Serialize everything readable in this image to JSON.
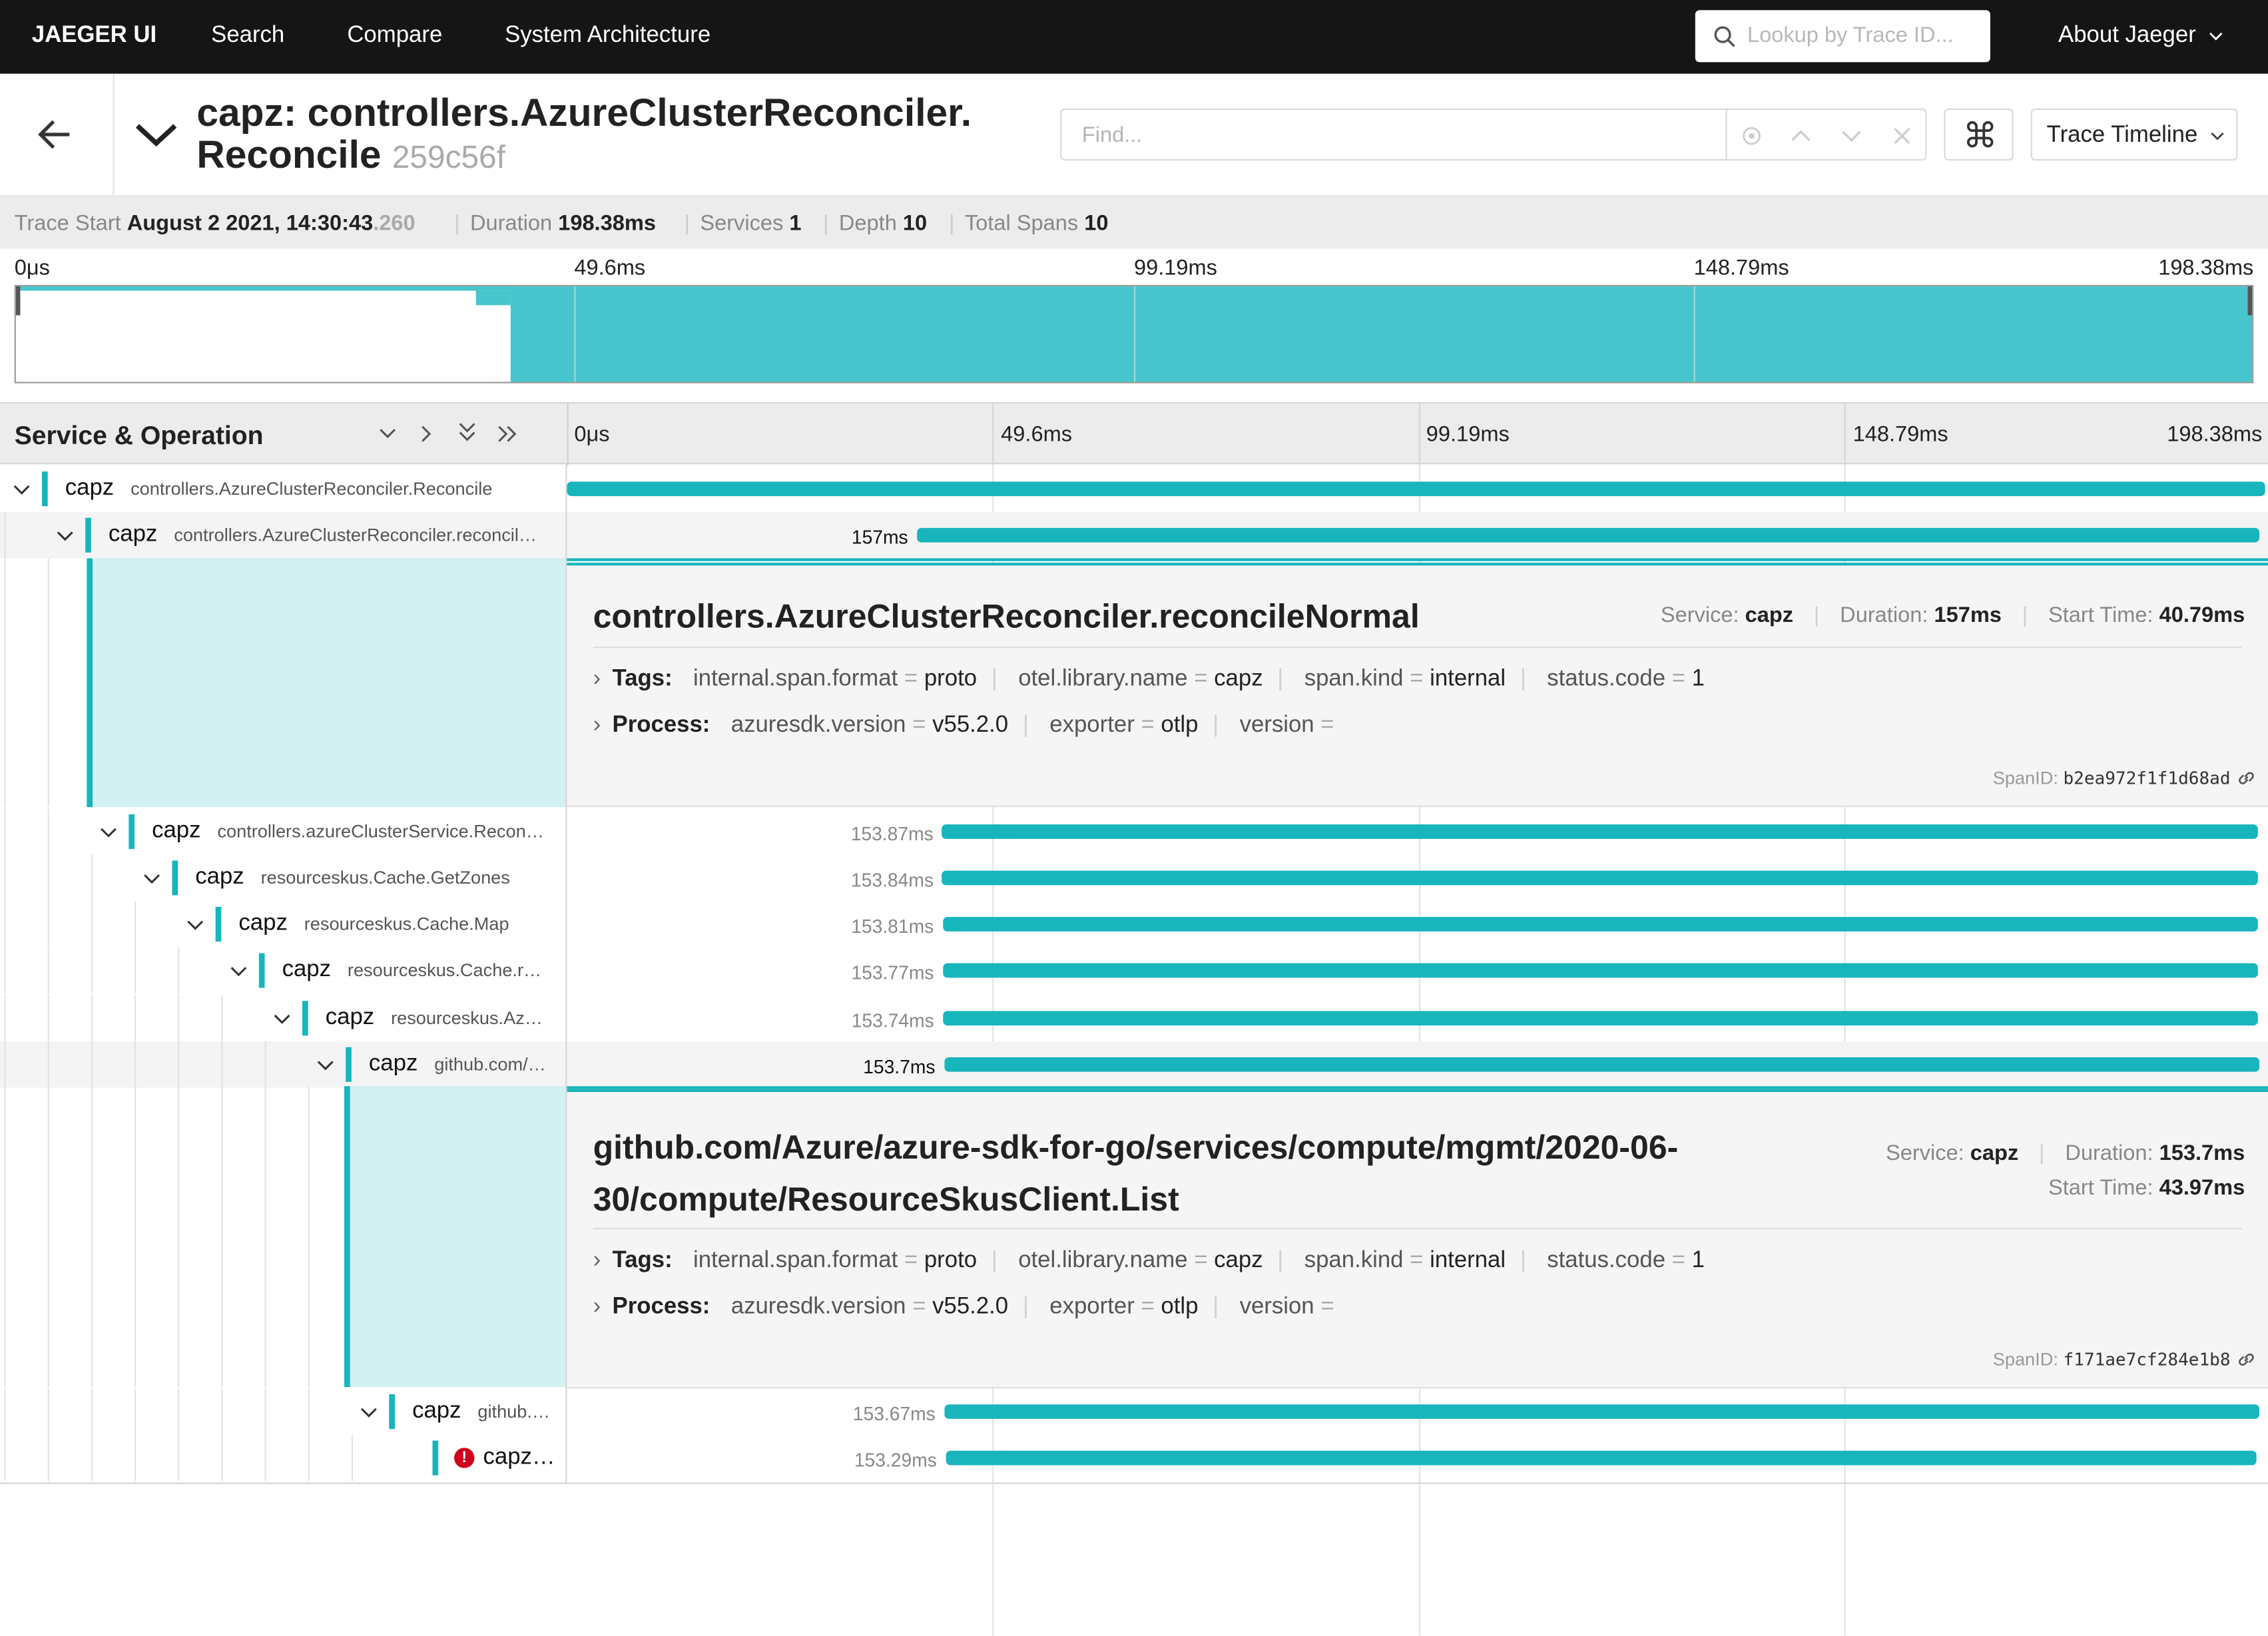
{
  "nav": {
    "brand": "JAEGER UI",
    "search": "Search",
    "compare": "Compare",
    "system_architecture": "System Architecture",
    "lookup_placeholder": "Lookup by Trace ID...",
    "about": "About Jaeger"
  },
  "trace": {
    "title_line1": "capz: controllers.AzureClusterReconciler.",
    "title_line2": "Reconcile",
    "trace_id": "259c56f",
    "find_placeholder": "Find...",
    "view_label": "Trace Timeline"
  },
  "summary": {
    "start_label": "Trace Start",
    "start_value": "August 2 2021, 14:30:43",
    "start_ms": ".260",
    "duration_label": "Duration",
    "duration_value": "198.38ms",
    "services_label": "Services",
    "services_value": "1",
    "depth_label": "Depth",
    "depth_value": "10",
    "spans_label": "Total Spans",
    "spans_value": "10"
  },
  "ticks": [
    "0μs",
    "49.6ms",
    "99.19ms",
    "148.79ms",
    "198.38ms"
  ],
  "grid": {
    "header_title": "Service & Operation"
  },
  "spans": [
    {
      "service": "capz",
      "operation": "controllers.AzureClusterReconciler.Reconcile",
      "duration": "",
      "start_frac": 0.0,
      "dur_frac": 1.0
    },
    {
      "service": "capz",
      "operation": "controllers.AzureClusterReconciler.reconcil…",
      "duration": "157ms",
      "start_frac": 0.2056,
      "dur_frac": 0.7914
    },
    {
      "service": "capz",
      "operation": "controllers.azureClusterService.Recon…",
      "duration": "153.87ms",
      "start_frac": 0.2205,
      "dur_frac": 0.7756
    },
    {
      "service": "capz",
      "operation": "resourceskus.Cache.GetZones",
      "duration": "153.84ms",
      "start_frac": 0.2206,
      "dur_frac": 0.7755
    },
    {
      "service": "capz",
      "operation": "resourceskus.Cache.Map",
      "duration": "153.81ms",
      "start_frac": 0.2207,
      "dur_frac": 0.7753
    },
    {
      "service": "capz",
      "operation": "resourceskus.Cache.r…",
      "duration": "153.77ms",
      "start_frac": 0.2208,
      "dur_frac": 0.7751
    },
    {
      "service": "capz",
      "operation": "resourceskus.Az…",
      "duration": "153.74ms",
      "start_frac": 0.2209,
      "dur_frac": 0.775
    },
    {
      "service": "capz",
      "operation": "github.com/…",
      "duration": "153.7ms",
      "start_frac": 0.2216,
      "dur_frac": 0.7748
    },
    {
      "service": "capz",
      "operation": "github.…",
      "duration": "153.67ms",
      "start_frac": 0.2217,
      "dur_frac": 0.7746
    },
    {
      "service": "capz…",
      "operation": "",
      "duration": "153.29ms",
      "start_frac": 0.2225,
      "dur_frac": 0.7727
    }
  ],
  "detail1": {
    "operation": "controllers.AzureClusterReconciler.reconcileNormal",
    "service_label": "Service:",
    "service_value": "capz",
    "duration_label": "Duration:",
    "duration_value": "157ms",
    "start_label": "Start Time:",
    "start_value": "40.79ms",
    "tags_label": "Tags:",
    "tags": [
      {
        "k": "internal.span.format",
        "v": "proto"
      },
      {
        "k": "otel.library.name",
        "v": "capz"
      },
      {
        "k": "span.kind",
        "v": "internal"
      },
      {
        "k": "status.code",
        "v": "1"
      }
    ],
    "process_label": "Process:",
    "process": [
      {
        "k": "azuresdk.version",
        "v": "v55.2.0"
      },
      {
        "k": "exporter",
        "v": "otlp"
      },
      {
        "k": "version",
        "v": ""
      }
    ],
    "spanid_label": "SpanID:",
    "spanid_value": "b2ea972f1f1d68ad"
  },
  "detail2": {
    "operation_line1": "github.com/Azure/azure-sdk-for-go/services/compute/mgmt/2020-06-",
    "operation_line2": "30/compute/ResourceSkusClient.List",
    "service_label": "Service:",
    "service_value": "capz",
    "duration_label": "Duration:",
    "duration_value": "153.7ms",
    "start_label": "Start Time:",
    "start_value": "43.97ms",
    "tags_label": "Tags:",
    "tags": [
      {
        "k": "internal.span.format",
        "v": "proto"
      },
      {
        "k": "otel.library.name",
        "v": "capz"
      },
      {
        "k": "span.kind",
        "v": "internal"
      },
      {
        "k": "status.code",
        "v": "1"
      }
    ],
    "process_label": "Process:",
    "process": [
      {
        "k": "azuresdk.version",
        "v": "v55.2.0"
      },
      {
        "k": "exporter",
        "v": "otlp"
      },
      {
        "k": "version",
        "v": ""
      }
    ],
    "spanid_label": "SpanID:",
    "spanid_value": "f171ae7cf284e1b8"
  },
  "colors": {
    "accent": "#18b5bd",
    "minimap_fill": "#46c6cc",
    "detail_stripe": "#d3f0f2",
    "error": "#d0021b"
  }
}
